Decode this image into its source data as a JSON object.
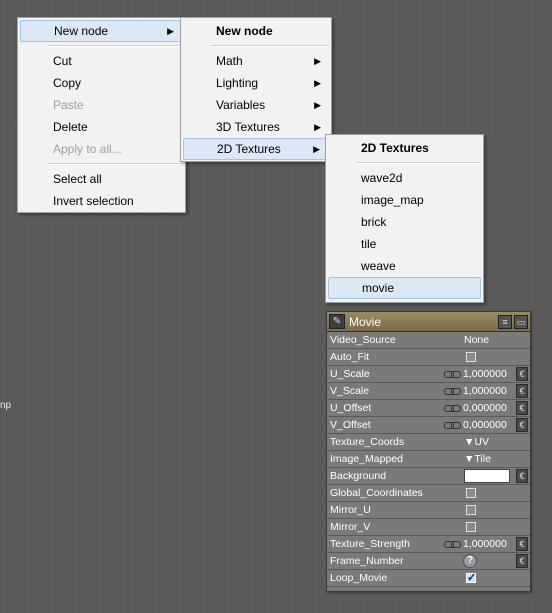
{
  "edge_label": "np",
  "context_menu": {
    "items": [
      {
        "label": "New node",
        "has_submenu": true,
        "highlighted": true
      },
      {
        "separator": true
      },
      {
        "label": "Cut"
      },
      {
        "label": "Copy"
      },
      {
        "label": "Paste",
        "disabled": true
      },
      {
        "label": "Delete"
      },
      {
        "label": "Apply to all...",
        "disabled": true
      },
      {
        "separator": true
      },
      {
        "label": "Select all"
      },
      {
        "label": "Invert selection"
      }
    ]
  },
  "new_node_menu": {
    "title": "New node",
    "items": [
      "Math",
      "Lighting",
      "Variables",
      "3D Textures",
      "2D Textures"
    ]
  },
  "textures_2d_menu": {
    "title": "2D Textures",
    "items": [
      "wave2d",
      "image_map",
      "brick",
      "tile",
      "weave",
      "movie"
    ]
  },
  "movie_node": {
    "title": "Movie",
    "header_color": "#8c7c56",
    "properties": {
      "video_source": {
        "name": "Video_Source",
        "value": "None"
      },
      "auto_fit": {
        "name": "Auto_Fit",
        "checked": false
      },
      "u_scale": {
        "name": "U_Scale",
        "value": "1,000000"
      },
      "v_scale": {
        "name": "V_Scale",
        "value": "1,000000"
      },
      "u_offset": {
        "name": "U_Offset",
        "value": "0,000000"
      },
      "v_offset": {
        "name": "V_Offset",
        "value": "0,000000"
      },
      "texture_coords": {
        "name": "Texture_Coords",
        "value": "▼UV"
      },
      "image_mapped": {
        "name": "Image_Mapped",
        "value": "▼Tile"
      },
      "background": {
        "name": "Background",
        "color": "#ffffff"
      },
      "global_coordinates": {
        "name": "Global_Coordinates",
        "checked": false
      },
      "mirror_u": {
        "name": "Mirror_U",
        "checked": false
      },
      "mirror_v": {
        "name": "Mirror_V",
        "checked": false
      },
      "texture_strength": {
        "name": "Texture_Strength",
        "value": "1,000000"
      },
      "frame_number": {
        "name": "Frame_Number",
        "value": "?"
      },
      "loop_movie": {
        "name": "Loop_Movie",
        "checked": true
      }
    }
  }
}
